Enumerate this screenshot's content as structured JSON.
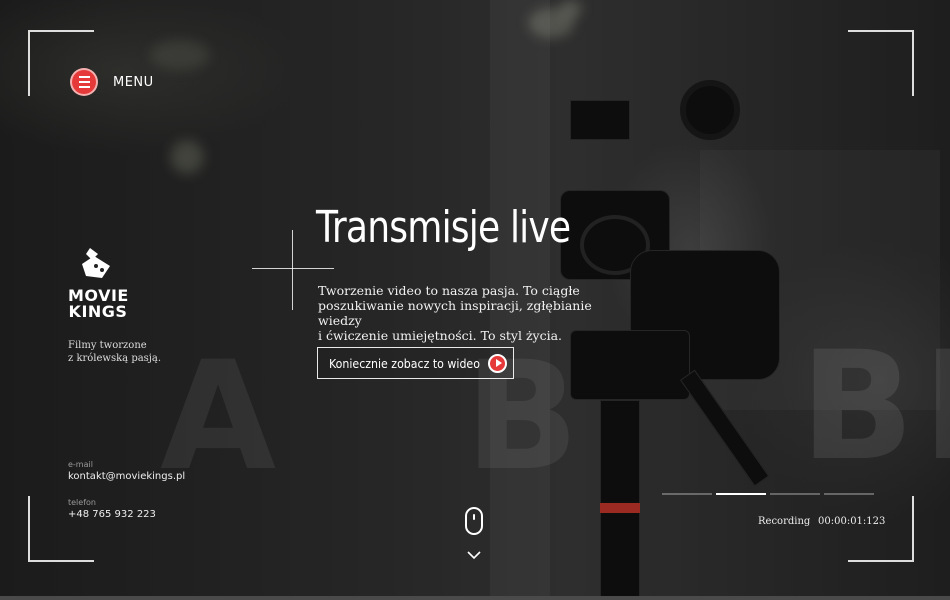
{
  "menu": {
    "label": "MENU"
  },
  "brand": {
    "name_line1": "MOVIE",
    "name_line2": "KINGS",
    "tagline_line1": "Filmy tworzone",
    "tagline_line2": "z królewską pasją."
  },
  "contact": {
    "email_label": "e-mail",
    "email": "kontakt@moviekings.pl",
    "phone_label": "telefon",
    "phone": "+48 765 932 223"
  },
  "hero": {
    "title": "Transmisje live",
    "lead_line1": "Tworzenie video to nasza pasja. To ciągłe",
    "lead_line2": "poszukiwanie nowych inspiracji, zgłębianie wiedzy",
    "lead_line3": "i ćwiczenie umiejętności. To styl życia.",
    "cta_label": "Koniecznie zobacz to wideo"
  },
  "slider": {
    "count": 4,
    "active_index": 1
  },
  "recording": {
    "label": "Recording",
    "timecode": "00:00:01:123"
  },
  "colors": {
    "accent": "#e63a3a",
    "text": "#ffffff"
  },
  "icons": [
    "menu-icon",
    "logo-icon",
    "play-icon",
    "mouse-icon",
    "chevron-down-icon"
  ]
}
